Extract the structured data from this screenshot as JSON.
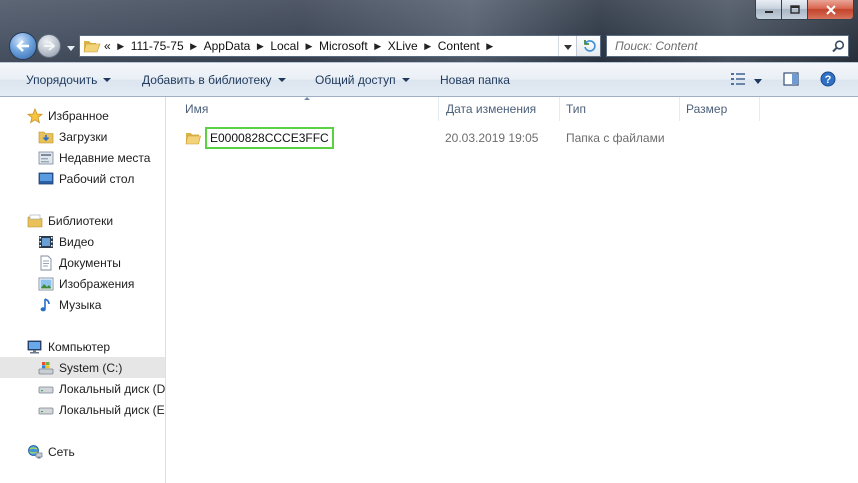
{
  "window": {
    "caption_buttons": [
      "minimize-icon",
      "maximize-icon",
      "close-icon"
    ]
  },
  "navigation": {
    "back_icon": "arrow-left-icon",
    "forward_icon": "arrow-right-icon",
    "breadcrumb_overflow": "«",
    "breadcrumb": [
      "111-75-75",
      "AppData",
      "Local",
      "Microsoft",
      "XLive",
      "Content"
    ],
    "search_placeholder": "Поиск: Content"
  },
  "toolbar": {
    "organize": "Упорядочить",
    "add_to_library": "Добавить в библиотеку",
    "share": "Общий доступ",
    "new_folder": "Новая папка"
  },
  "sidebar": {
    "favorites": {
      "label": "Избранное",
      "items": [
        "Загрузки",
        "Недавние места",
        "Рабочий стол"
      ]
    },
    "libraries": {
      "label": "Библиотеки",
      "items": [
        "Видео",
        "Документы",
        "Изображения",
        "Музыка"
      ]
    },
    "computer": {
      "label": "Компьютер",
      "items": [
        "System (C:)",
        "Локальный диск (D",
        "Локальный диск (E:"
      ]
    },
    "network": {
      "label": "Сеть"
    }
  },
  "file_list": {
    "columns": [
      "Имя",
      "Дата изменения",
      "Тип",
      "Размер"
    ],
    "rows": [
      {
        "name": "E0000828CCCE3FFC",
        "date": "20.03.2019 19:05",
        "type": "Папка с файлами",
        "size": ""
      }
    ]
  },
  "colors": {
    "rename_outline": "#5ad043",
    "command_text": "#1e395b",
    "header_text": "#4c607a"
  }
}
